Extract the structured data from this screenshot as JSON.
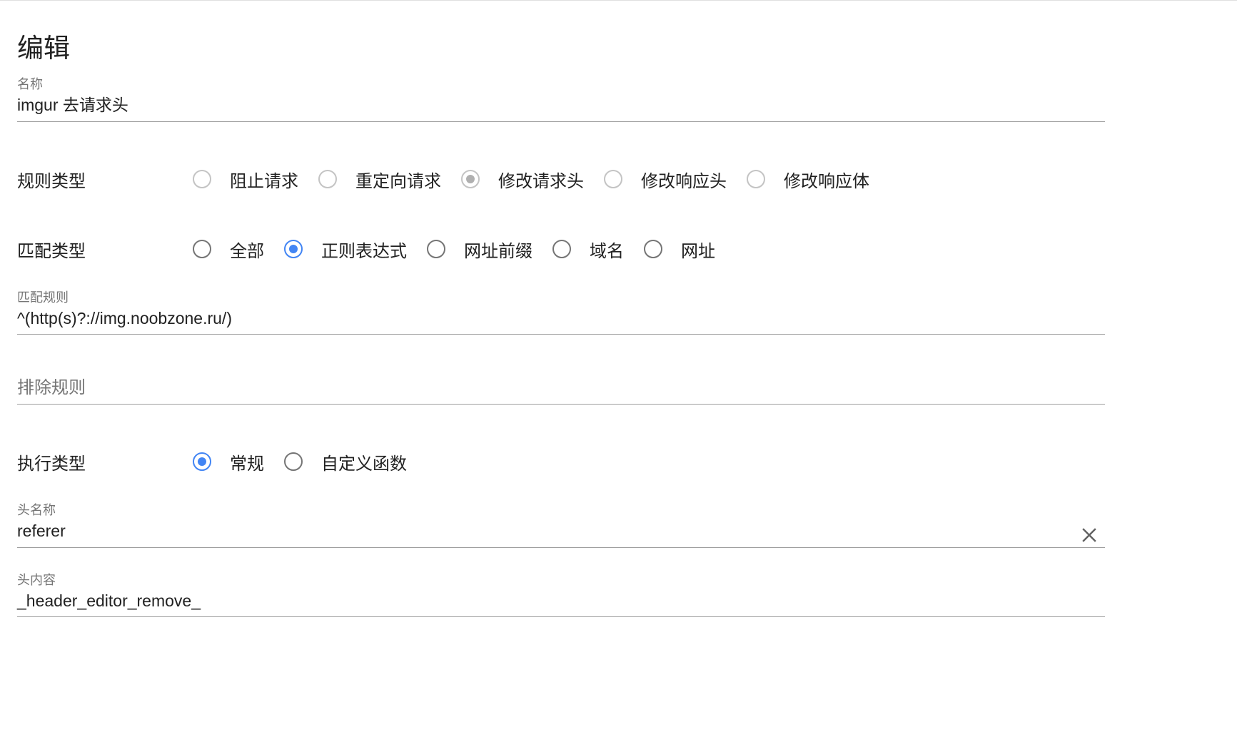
{
  "header": {
    "title": "编辑"
  },
  "name_field": {
    "label": "名称",
    "value": "imgur 去请求头"
  },
  "rule_type": {
    "label": "规则类型",
    "options": [
      {
        "label": "阻止请求",
        "checked": false,
        "disabled": true
      },
      {
        "label": "重定向请求",
        "checked": false,
        "disabled": true
      },
      {
        "label": "修改请求头",
        "checked": true,
        "disabled": true
      },
      {
        "label": "修改响应头",
        "checked": false,
        "disabled": true
      },
      {
        "label": "修改响应体",
        "checked": false,
        "disabled": true
      }
    ]
  },
  "match_type": {
    "label": "匹配类型",
    "options": [
      {
        "label": "全部",
        "checked": false
      },
      {
        "label": "正则表达式",
        "checked": true
      },
      {
        "label": "网址前缀",
        "checked": false
      },
      {
        "label": "域名",
        "checked": false
      },
      {
        "label": "网址",
        "checked": false
      }
    ]
  },
  "match_rule_field": {
    "label": "匹配规则",
    "value": "^(http(s)?://img.noobzone.ru/)"
  },
  "exclude_rule_field": {
    "placeholder": "排除规则"
  },
  "exec_type": {
    "label": "执行类型",
    "options": [
      {
        "label": "常规",
        "checked": true
      },
      {
        "label": "自定义函数",
        "checked": false
      }
    ]
  },
  "header_name_field": {
    "label": "头名称",
    "value": "referer",
    "clear_icon": "close-icon"
  },
  "header_value_field": {
    "label": "头内容",
    "value": "_header_editor_remove_"
  },
  "colors": {
    "accent": "#4285f4",
    "text": "#212121",
    "secondary_text": "#757575",
    "underline": "#9e9e9e"
  }
}
